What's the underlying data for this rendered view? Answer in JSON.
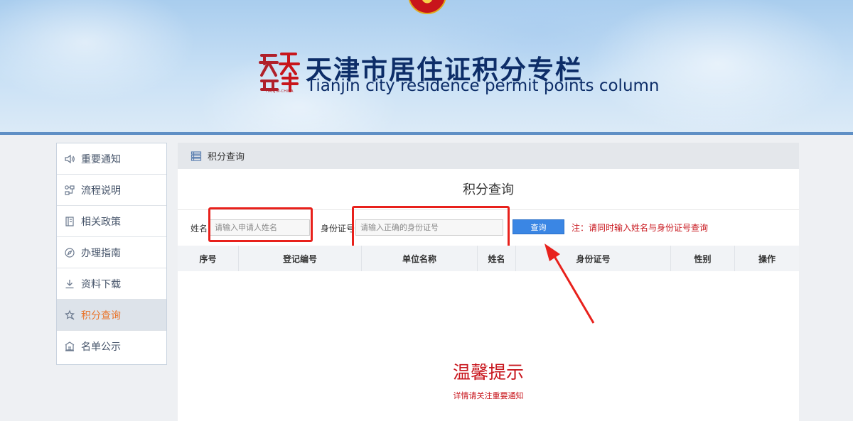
{
  "header": {
    "title_cn": "天津市居住证积分专栏",
    "title_en": "Tianjin city residence permit points column",
    "logo_caption": "TIANJIN·CHINA"
  },
  "sidebar": {
    "items": [
      {
        "label": "重要通知",
        "icon": "speaker-icon",
        "active": false
      },
      {
        "label": "流程说明",
        "icon": "flow-icon",
        "active": false
      },
      {
        "label": "相关政策",
        "icon": "document-icon",
        "active": false
      },
      {
        "label": "办理指南",
        "icon": "compass-icon",
        "active": false
      },
      {
        "label": "资料下载",
        "icon": "download-icon",
        "active": false
      },
      {
        "label": "积分查询",
        "icon": "star-search-icon",
        "active": true
      },
      {
        "label": "名单公示",
        "icon": "building-icon",
        "active": false
      }
    ]
  },
  "main": {
    "breadcrumb": "积分查询",
    "panel_title": "积分查询",
    "search": {
      "name_label": "姓名",
      "name_placeholder": "请输入申请人姓名",
      "id_label": "身份证号",
      "id_placeholder": "请输入正确的身份证号",
      "button_label": "查询",
      "note": "注：请同时输入姓名与身份证号查询"
    },
    "table": {
      "columns": [
        "序号",
        "登记编号",
        "单位名称",
        "姓名",
        "身份证号",
        "性别",
        "操作"
      ]
    },
    "tip": {
      "title": "温馨提示",
      "subtitle": "详情请关注重要通知"
    }
  },
  "colors": {
    "accent": "#3a86e4",
    "active_item": "#e9762e",
    "warning": "#c8161d",
    "banner_title": "#0d2d68"
  }
}
